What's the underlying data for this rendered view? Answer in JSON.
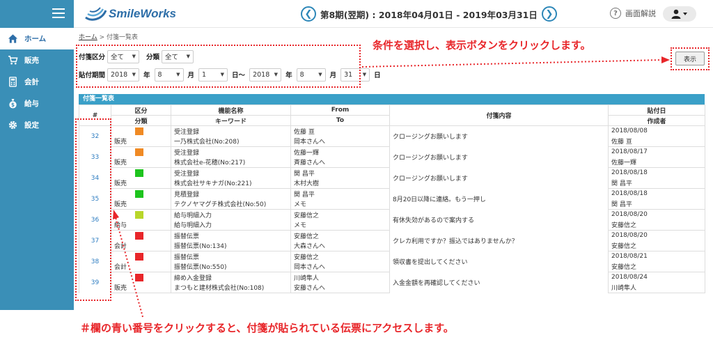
{
  "header": {
    "logo_text": "SmileWorks",
    "period": "第8期(翌期) : 2018年04月01日 - 2019年03月31日",
    "prev": "❮",
    "next": "❯",
    "help_label": "画面解説"
  },
  "sidebar": {
    "items": [
      {
        "label": "ホーム",
        "icon": "home-icon"
      },
      {
        "label": "販売",
        "icon": "cart-icon"
      },
      {
        "label": "会計",
        "icon": "calculator-icon"
      },
      {
        "label": "給与",
        "icon": "money-bag-icon"
      },
      {
        "label": "設定",
        "icon": "gear-icon"
      }
    ]
  },
  "breadcrumb": {
    "home": "ホーム",
    "sep": ">",
    "current": "付箋一覧表"
  },
  "filters": {
    "type_label": "付箋区分",
    "type_value": "全て",
    "cat_label": "分類",
    "cat_value": "全て",
    "period_label": "貼付期間",
    "from_year": "2018",
    "from_month": "8",
    "from_day": "1",
    "to_year": "2018",
    "to_month": "8",
    "to_day": "31",
    "year_unit": "年",
    "month_unit": "月",
    "day_unit": "日",
    "tilde": "日〜",
    "show_button": "表示"
  },
  "annotations": {
    "top": "条件を選択し、表示ボタンをクリックします。",
    "bottom": "＃欄の青い番号をクリックすると、付箋が貼られている伝票にアクセスします。"
  },
  "table": {
    "title": "付箋一覧表",
    "headers": {
      "num": "#",
      "kubun": "区分",
      "bunrui": "分類",
      "func": "機能名称",
      "keyword": "キーワード",
      "from": "From",
      "to": "To",
      "content": "付箋内容",
      "date": "貼付日",
      "creator": "作成者"
    },
    "rows": [
      {
        "num": "32",
        "cat": "販売",
        "color": "#f08a24",
        "func": "受注登録",
        "keyword": "一乃株式会社(No:208)",
        "from": "佐藤 亘",
        "to": "岡本さんへ",
        "content": "クロージングお願いします",
        "date": "2018/08/08",
        "creator": "佐藤 亘"
      },
      {
        "num": "33",
        "cat": "販売",
        "color": "#f08a24",
        "func": "受注登録",
        "keyword": "株式会社e-花穂(No:217)",
        "from": "佐藤一輝",
        "to": "斉藤さんへ",
        "content": "クロージングお願いします",
        "date": "2018/08/17",
        "creator": "佐藤一輝"
      },
      {
        "num": "34",
        "cat": "販売",
        "color": "#1ec41e",
        "func": "受注登録",
        "keyword": "株式会社サキナガ(No:221)",
        "from": "関 昌平",
        "to": "木村大樹",
        "content": "クロージングお願いします",
        "date": "2018/08/18",
        "creator": "関 昌平"
      },
      {
        "num": "35",
        "cat": "販売",
        "color": "#1ec41e",
        "func": "見積登録",
        "keyword": "テクノヤマグチ株式会社(No:50)",
        "from": "関 昌平",
        "to": "メモ",
        "content": "8月20日以降に連絡。もう一押し",
        "date": "2018/08/18",
        "creator": "関 昌平"
      },
      {
        "num": "36",
        "cat": "給与",
        "color": "#b8d62a",
        "func": "給与明細入力",
        "keyword": "給与明細入力",
        "from": "安藤信之",
        "to": "メモ",
        "content": "有休失効があるので案内する",
        "date": "2018/08/20",
        "creator": "安藤信之"
      },
      {
        "num": "37",
        "cat": "会計",
        "color": "#e8262a",
        "func": "振替伝票",
        "keyword": "振替伝票(No:134)",
        "from": "安藤信之",
        "to": "大森さんへ",
        "content": "クレカ利用ですか？振込ではありませんか？",
        "date": "2018/08/20",
        "creator": "安藤信之"
      },
      {
        "num": "38",
        "cat": "会計",
        "color": "#e8262a",
        "func": "振替伝票",
        "keyword": "振替伝票(No:550)",
        "from": "安藤信之",
        "to": "岡本さんへ",
        "content": "領収書を提出してください",
        "date": "2018/08/21",
        "creator": "安藤信之"
      },
      {
        "num": "39",
        "cat": "販売",
        "color": "#e8262a",
        "func": "締め入金登録",
        "keyword": "まつもと建材株式会社(No:108)",
        "from": "川崎隼人",
        "to": "安藤さんへ",
        "content": "入金金額を再確認してください",
        "date": "2018/08/24",
        "creator": "川崎隼人"
      }
    ]
  }
}
